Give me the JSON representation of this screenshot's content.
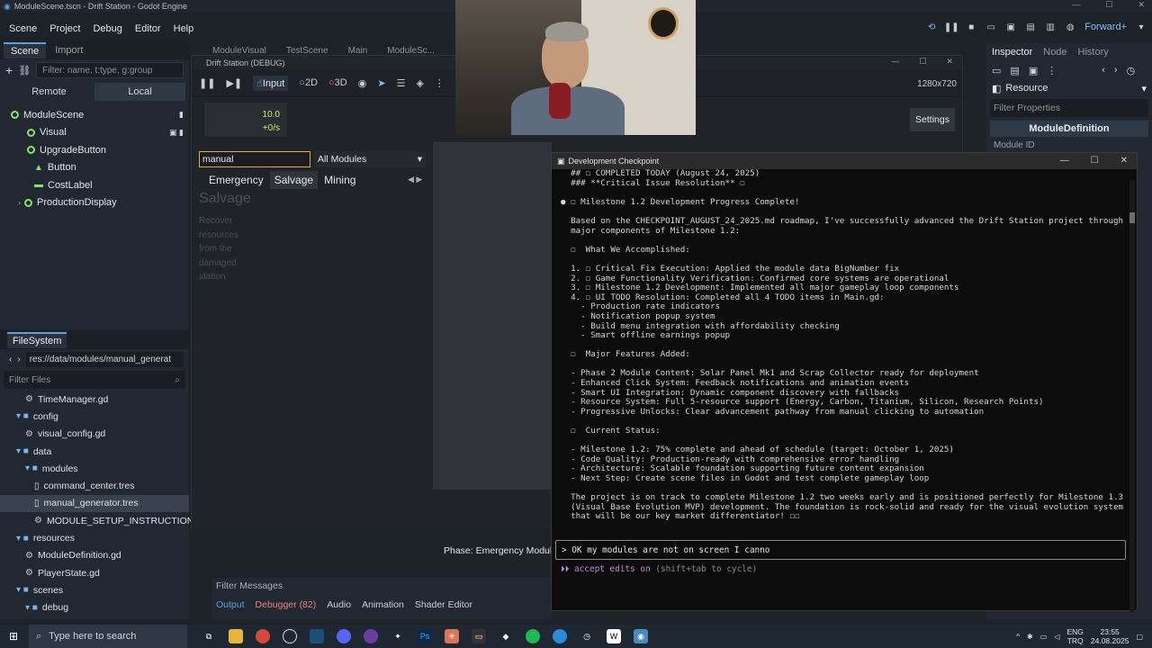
{
  "window": {
    "title": "ModuleScene.tscn - Drift Station - Godot Engine",
    "min": "—",
    "max": "☐",
    "close": "✕"
  },
  "menu": [
    "Scene",
    "Project",
    "Debug",
    "Editor",
    "Help"
  ],
  "renderer": "Forward+",
  "scene_dock": {
    "tabs": [
      "Scene",
      "Import"
    ],
    "filter_placeholder": "Filter: name, t:type, g:group",
    "remote": "Remote",
    "local": "Local",
    "nodes": [
      {
        "label": "ModuleScene",
        "indent": 0
      },
      {
        "label": "Visual",
        "indent": 1
      },
      {
        "label": "UpgradeButton",
        "indent": 1
      },
      {
        "label": "Button",
        "indent": 2
      },
      {
        "label": "CostLabel",
        "indent": 2
      },
      {
        "label": "ProductionDisplay",
        "indent": 1
      }
    ]
  },
  "filesystem": {
    "title": "FileSystem",
    "path": "res://data/modules/manual_generat",
    "filter": "Filter Files",
    "items": [
      {
        "label": "TimeManager.gd",
        "type": "gear",
        "indent": 2
      },
      {
        "label": "config",
        "type": "folder",
        "indent": 1
      },
      {
        "label": "visual_config.gd",
        "type": "gear",
        "indent": 2
      },
      {
        "label": "data",
        "type": "folder",
        "indent": 1
      },
      {
        "label": "modules",
        "type": "folder",
        "indent": 2
      },
      {
        "label": "command_center.tres",
        "type": "doc",
        "indent": 3
      },
      {
        "label": "manual_generator.tres",
        "type": "doc",
        "indent": 3,
        "selected": true
      },
      {
        "label": "MODULE_SETUP_INSTRUCTIONS...",
        "type": "gear",
        "indent": 3
      },
      {
        "label": "resources",
        "type": "folder",
        "indent": 1
      },
      {
        "label": "ModuleDefinition.gd",
        "type": "gear",
        "indent": 2
      },
      {
        "label": "PlayerState.gd",
        "type": "gear",
        "indent": 2
      },
      {
        "label": "scenes",
        "type": "folder",
        "indent": 1
      },
      {
        "label": "debug",
        "type": "folder",
        "indent": 2
      }
    ]
  },
  "editor_tabs": [
    "ModuleVisual",
    "TestScene",
    "Main",
    "ModuleSc..."
  ],
  "game": {
    "title": "Drift Station (DEBUG)",
    "tools": {
      "input": "Input",
      "d2": "2D",
      "d3": "3D"
    },
    "resolution": "1280x720",
    "stat_value": "10.0",
    "stat_rate": "+0/s",
    "settings": "Settings",
    "search": "manual",
    "filter": "All Modules",
    "tabs": [
      "Emergency",
      "Salvage",
      "Mining"
    ],
    "active_tab": "Salvage",
    "heading": "Salvage",
    "desc": [
      "Recover",
      "resources",
      "from the",
      "damaged",
      "station"
    ],
    "phase": "Phase: Emergency Module"
  },
  "inspector": {
    "tabs": [
      "Inspector",
      "Node",
      "History"
    ],
    "resource": "Resource",
    "filter": "Filter Properties",
    "def": "ModuleDefinition",
    "field": "Module ID"
  },
  "bottom": {
    "filter": "Filter Messages",
    "tabs": [
      "Output",
      "Debugger (82)",
      "Audio",
      "Animation",
      "Shader Editor"
    ]
  },
  "terminal": {
    "title": "Development Checkpoint",
    "lines": [
      "  ## ☐ COMPLETED TODAY (August 24, 2025)",
      "  ### **Critical Issue Resolution** ☐",
      "",
      "● ☐ Milestone 1.2 Development Progress Complete!",
      "",
      "  Based on the CHECKPOINT_AUGUST_24_2025.md roadmap, I've successfully advanced the Drift Station project through",
      "  major components of Milestone 1.2:",
      "",
      "  ☐  What We Accomplished:",
      "",
      "  1. ☐ Critical Fix Execution: Applied the module data BigNumber fix",
      "  2. ☐ Game Functionality Verification: Confirmed core systems are operational",
      "  3. ☐ Milestone 1.2 Development: Implemented all major gameplay loop components",
      "  4. ☐ UI TODO Resolution: Completed all 4 TODO items in Main.gd:",
      "    - Production rate indicators",
      "    - Notification popup system",
      "    - Build menu integration with affordability checking",
      "    - Smart offline earnings popup",
      "",
      "  ☐  Major Features Added:",
      "",
      "  - Phase 2 Module Content: Solar Panel Mk1 and Scrap Collector ready for deployment",
      "  - Enhanced Click System: Feedback notifications and animation events",
      "  - Smart UI Integration: Dynamic component discovery with fallbacks",
      "  - Resource System: Full 5-resource support (Energy, Carbon, Titanium, Silicon, Research Points)",
      "  - Progressive Unlocks: Clear advancement pathway from manual clicking to automation",
      "",
      "  ☐  Current Status:",
      "",
      "  - Milestone 1.2: 75% complete and ahead of schedule (target: October 1, 2025)",
      "  - Code Quality: Production-ready with comprehensive error handling",
      "  - Architecture: Scalable foundation supporting future content expansion",
      "  - Next Step: Create scene files in Godot and test complete gameplay loop",
      "",
      "  The project is on track to complete Milestone 1.2 two weeks early and is positioned perfectly for Milestone 1.3",
      "  (Visual Base Evolution MVP) development. The foundation is rock-solid and ready for the visual evolution system",
      "  that will be our key market differentiator! ☐☐"
    ],
    "prompt": "> OK my modules are not on screen I canno",
    "accept": "⏵⏵ accept edits on",
    "accept_hint": " (shift+tab to cycle)"
  },
  "taskbar": {
    "search": "Type here to search",
    "lang1": "ENG",
    "lang2": "TRQ",
    "time": "23:55",
    "date": "24.08.2025"
  }
}
